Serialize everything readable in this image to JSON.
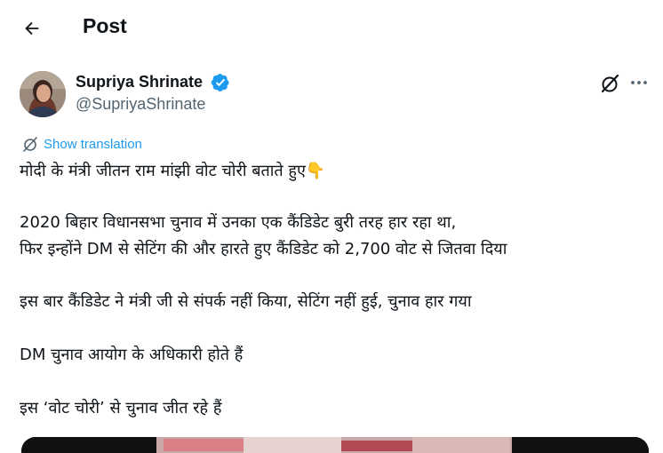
{
  "header": {
    "title": "Post"
  },
  "tweet": {
    "author_name": "Supriya Shrinate",
    "author_handle": "@SupriyaShrinate",
    "translate_label": "Show translation",
    "lines": [
      "मोदी के मंत्री जीतन राम मांझी वोट चोरी बताते हुए👇",
      "2020 बिहार विधानसभा चुनाव में उनका एक कैंडिडेट बुरी तरह हार रहा था,",
      "फिर इन्होंने DM से सेटिंग की और हारते हुए कैंडिडेट को 2,700 वोट से जितवा दिया",
      "इस बार कैंडिडेट ने मंत्री जी से संपर्क नहीं किया, सेटिंग नहीं हुई, चुनाव हार गया",
      "DM चुनाव आयोग के अधिकारी होते हैं",
      "इस ‘वोट चोरी’ से चुनाव जीत रहे हैं"
    ]
  },
  "icons": {
    "back": "arrow-left-icon",
    "verified": "verified-badge-icon",
    "grok": "grok-icon",
    "more": "more-horizontal-icon",
    "translate": "translate-icon"
  },
  "colors": {
    "text": "#0f1419",
    "secondary": "#536471",
    "accent": "#1d9bf0"
  }
}
